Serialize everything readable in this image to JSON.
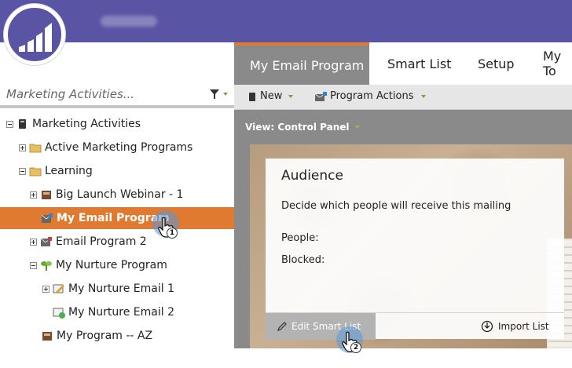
{
  "colors": {
    "brand_purple": "#5a54a4",
    "selected_orange": "#e07a31",
    "panel_gray": "#8a8a8a"
  },
  "search": {
    "placeholder": "Marketing Activities..."
  },
  "tree": [
    {
      "label": "Marketing Activities",
      "icon": "marketing-activities-icon",
      "expander": "minus"
    },
    {
      "label": "Active Marketing Programs",
      "icon": "folder-icon",
      "expander": "plus"
    },
    {
      "label": "Learning",
      "icon": "folder-icon",
      "expander": "minus"
    },
    {
      "label": "Big Launch Webinar - 1",
      "icon": "event-program-icon",
      "expander": "plus"
    },
    {
      "label": "My Email Program",
      "icon": "email-program-icon",
      "expander": "none",
      "selected": true
    },
    {
      "label": "Email Program 2",
      "icon": "email-program-icon",
      "expander": "plus"
    },
    {
      "label": "My Nurture Program",
      "icon": "nurture-program-icon",
      "expander": "minus"
    },
    {
      "label": "My Nurture Email 1",
      "icon": "nurture-email-icon",
      "expander": "plus"
    },
    {
      "label": "My Nurture Email 2",
      "icon": "nurture-email-icon",
      "expander": "none"
    },
    {
      "label": "My Program -- AZ",
      "icon": "program-icon",
      "expander": "none"
    }
  ],
  "tabs": [
    {
      "label": "My Email Program",
      "active": true
    },
    {
      "label": "Smart List"
    },
    {
      "label": "Setup"
    },
    {
      "label": "My To"
    }
  ],
  "toolbar": {
    "new_label": "New",
    "program_actions_label": "Program Actions"
  },
  "view": {
    "label": "View: Control Panel"
  },
  "audience": {
    "title": "Audience",
    "description": "Decide which people will receive this mailing",
    "people_label": "People:",
    "blocked_label": "Blocked:",
    "edit_label": "Edit Smart List",
    "import_label": "Import List"
  },
  "cursors": {
    "step1": "1",
    "step2": "2"
  }
}
